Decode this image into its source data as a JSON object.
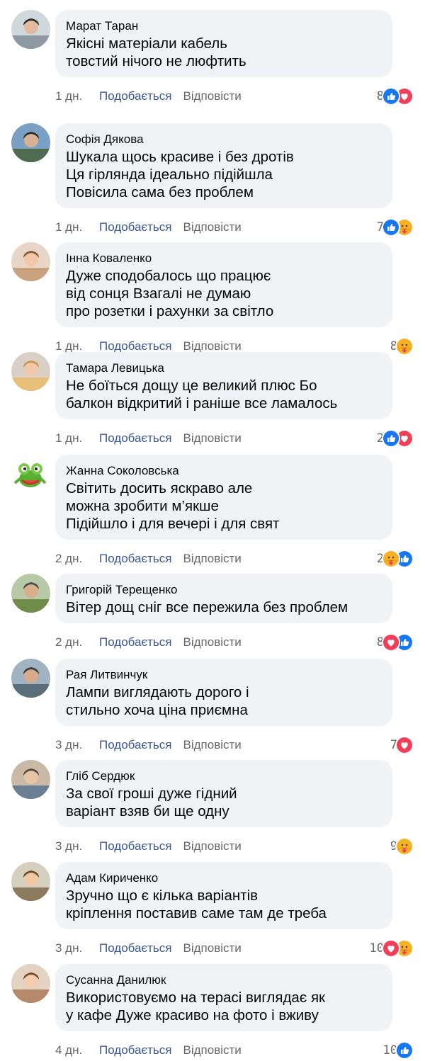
{
  "actions": {
    "like": "Подобається",
    "reply": "Відповісти"
  },
  "colors": {
    "like_blue": "#1877f2",
    "love_red": "#f33e58",
    "care_yellow": "#f7b125",
    "bubble": "#f0f2f5",
    "link": "#385898"
  },
  "comments": [
    {
      "author": "Марат Таран",
      "lines": [
        "Якісні матеріали кабель",
        "товстий нічого не люфтить"
      ],
      "time": "1 дн.",
      "count": "8",
      "reactions": [
        "like-icon",
        "love-icon"
      ]
    },
    {
      "author": "Софія Дякова",
      "lines": [
        "Шукала щось красиве і без дротів",
        "Ця гірлянда ідеально підійшла",
        "Повісила сама без проблем"
      ],
      "time": "1 дн.",
      "count": "7",
      "reactions": [
        "like-icon",
        "care-icon"
      ]
    },
    {
      "author": "Інна Коваленко",
      "lines": [
        "Дуже сподобалось що працює",
        "від сонця Взагалі не думаю",
        "про розетки і рахунки за світло"
      ],
      "time": "1 дн.",
      "count": "8",
      "reactions": [
        "care-icon"
      ]
    },
    {
      "author": "Тамара Левицька",
      "lines": [
        "Не боїться дощу це великий плюс Бо",
        "балкон відкритий і раніше все ламалось"
      ],
      "time": "1 дн.",
      "count": "2",
      "reactions": [
        "like-icon",
        "love-icon"
      ]
    },
    {
      "author": "Жанна Соколовська",
      "lines": [
        "Світить досить яскраво але",
        "можна зробити м’якше",
        "Підійшло і для вечері і для свят"
      ],
      "time": "2 дн.",
      "count": "2",
      "reactions": [
        "care-icon",
        "like-icon"
      ]
    },
    {
      "author": "Григорій Терещенко",
      "lines": [
        "Вітер дощ сніг все пережила без проблем"
      ],
      "time": "2 дн.",
      "count": "8",
      "reactions": [
        "love-icon",
        "like-icon"
      ]
    },
    {
      "author": "Рая Литвинчук",
      "lines": [
        "Лампи виглядають дорого і",
        "стильно хоча ціна приємна"
      ],
      "time": "3 дн.",
      "count": "7",
      "reactions": [
        "love-icon"
      ]
    },
    {
      "author": "Гліб Сердюк",
      "lines": [
        "За свої гроші дуже гідний",
        "варіант взяв би ще одну"
      ],
      "time": "3 дн.",
      "count": "9",
      "reactions": [
        "care-icon"
      ]
    },
    {
      "author": "Адам Кириченко",
      "lines": [
        "Зручно що є кілька варіантів",
        "кріплення поставив саме там де треба"
      ],
      "time": "3 дн.",
      "count": "10",
      "reactions": [
        "love-icon",
        "care-icon"
      ]
    },
    {
      "author": "Сусанна Данилюк",
      "lines": [
        "Використовуємо на терасі виглядає як",
        "у кафе Дуже красиво на фото і вживу"
      ],
      "time": "4 дн.",
      "count": "10",
      "reactions": [
        "like-icon"
      ]
    }
  ]
}
